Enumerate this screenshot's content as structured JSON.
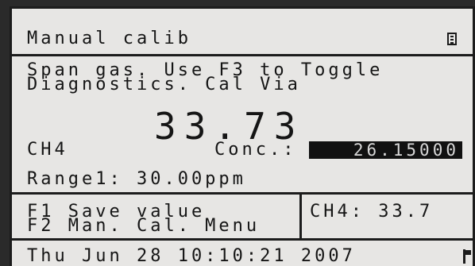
{
  "header": {
    "title": "Manual calib",
    "menu_icon": "menu-lines-icon"
  },
  "message": {
    "line1": "Span gas. Use F3 to Toggle",
    "line2": "Diagnostics. Cal Via"
  },
  "reading": {
    "main_value": "33.73",
    "gas_label": "CH4",
    "conc_label": "Conc.:",
    "conc_value": "26.15000"
  },
  "range": {
    "text": "Range1: 30.00ppm"
  },
  "function_keys": {
    "f1": "F1 Save value",
    "f2": "F2 Man. Cal. Menu"
  },
  "side_reading": {
    "text": "CH4: 33.7"
  },
  "status_bar": {
    "datetime": "Thu Jun 28 10:10:21 2007",
    "corner_icon": "flag-icon"
  }
}
